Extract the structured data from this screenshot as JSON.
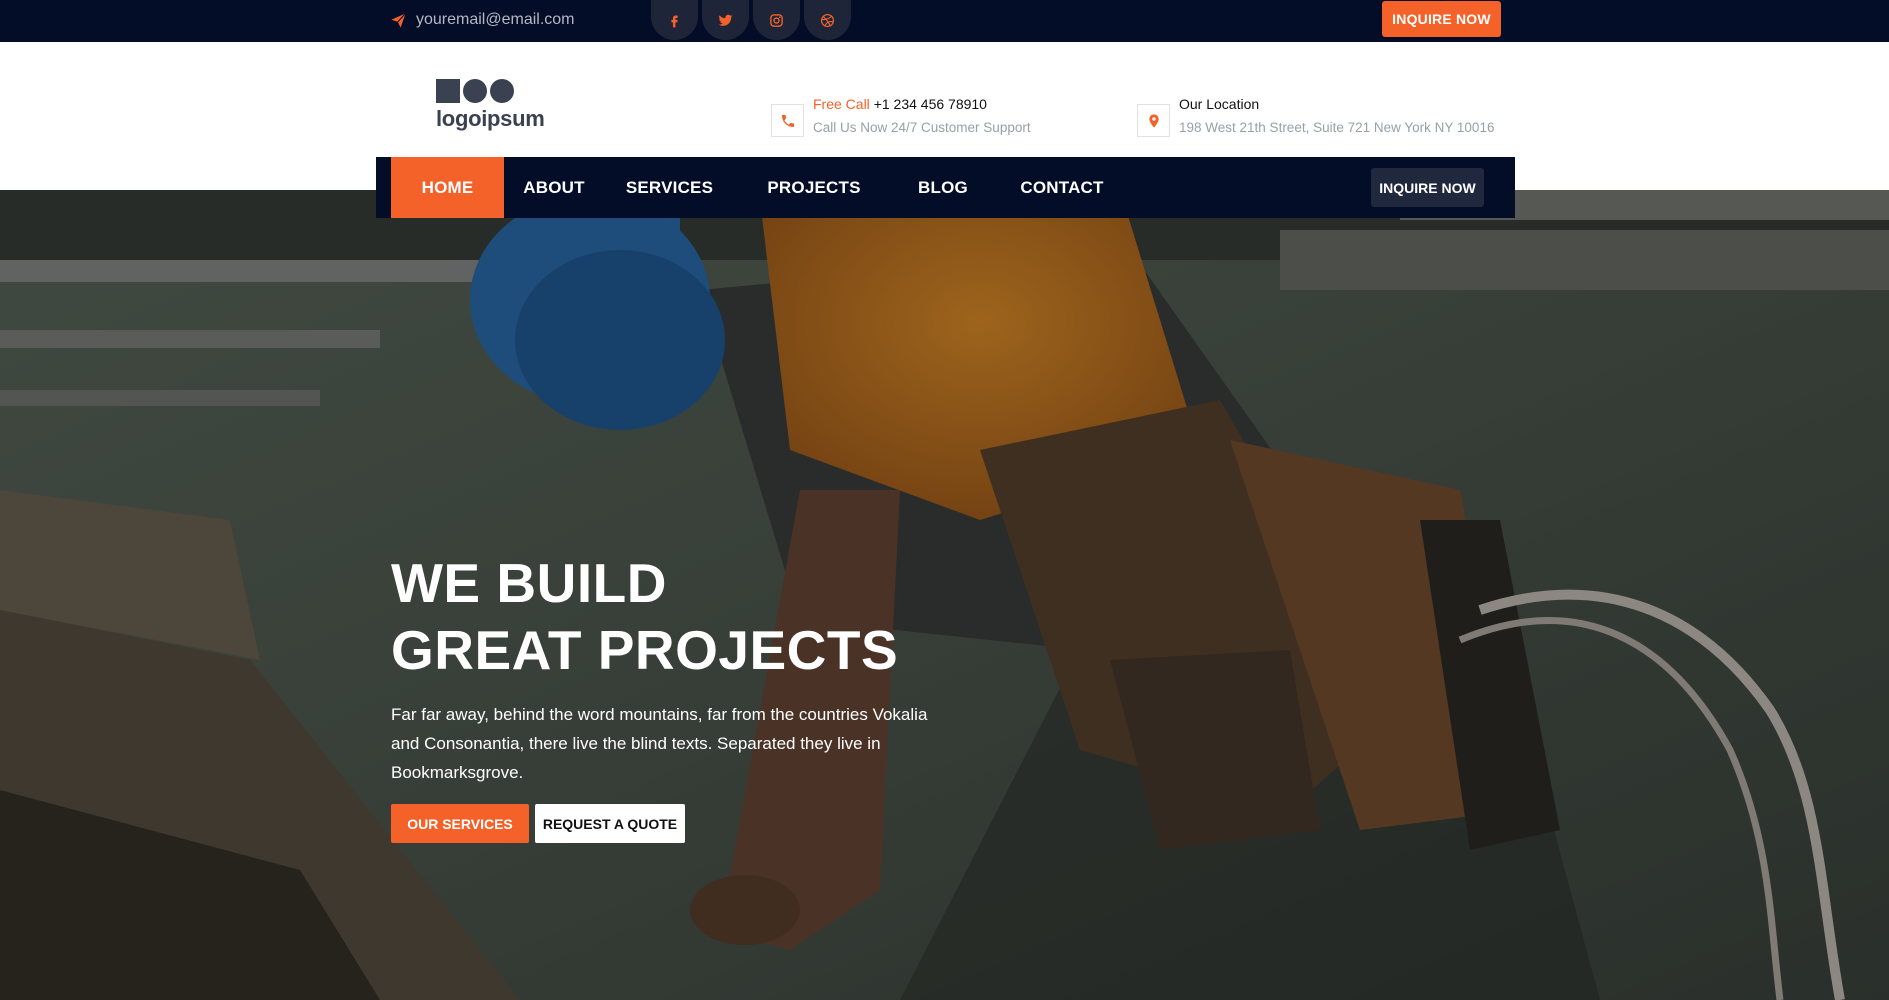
{
  "topbar": {
    "email": "youremail@email.com",
    "socials": [
      "facebook-icon",
      "twitter-icon",
      "instagram-icon",
      "dribbble-icon"
    ],
    "cta_label": "INQUIRE NOW"
  },
  "header": {
    "logo_text": "logoipsum",
    "phone": {
      "accent_label": "Free Call",
      "number": "+1 234 456 78910",
      "sub": "Call Us Now 24/7 Customer Support"
    },
    "location": {
      "label": "Our Location",
      "address": "198 West 21th Street, Suite 721 New York NY 10016"
    }
  },
  "nav": {
    "items": [
      {
        "label": "HOME",
        "active": true
      },
      {
        "label": "ABOUT",
        "active": false
      },
      {
        "label": "SERVICES",
        "active": false
      },
      {
        "label": "PROJECTS",
        "active": false
      },
      {
        "label": "BLOG",
        "active": false
      },
      {
        "label": "CONTACT",
        "active": false
      }
    ],
    "cta_label": "INQUIRE NOW"
  },
  "hero": {
    "title_line1": "WE BUILD",
    "title_line2": "GREAT PROJECTS",
    "text": "Far far away, behind the word mountains, far from the countries Vokalia and Consonantia, there live the blind texts. Separated they live in Bookmarksgrove.",
    "primary_button": "OUR SERVICES",
    "secondary_button": "REQUEST A QUOTE"
  },
  "colors": {
    "accent": "#f4622a",
    "navy": "#040d28",
    "nav_button": "#20283d"
  }
}
